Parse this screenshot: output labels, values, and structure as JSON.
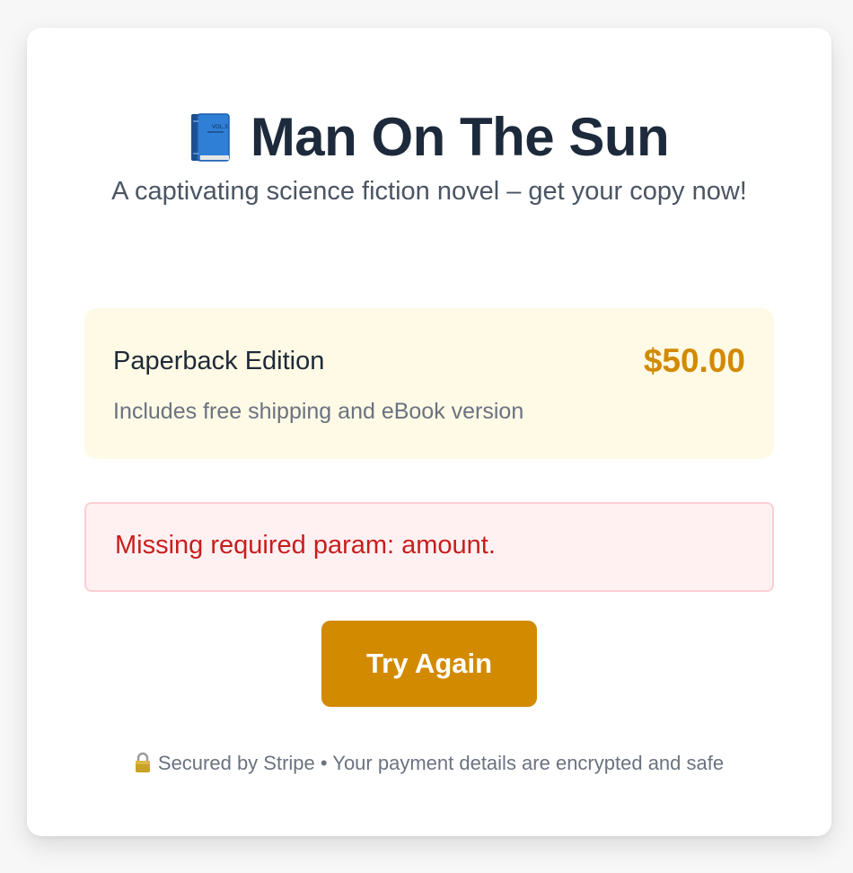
{
  "header": {
    "book_icon": "blue-book-icon",
    "title": "Man On The Sun",
    "subtitle": "A captivating science fiction novel – get your copy now!"
  },
  "product": {
    "name": "Paperback Edition",
    "price": "$50.00",
    "description": "Includes free shipping and eBook version"
  },
  "error": {
    "message": "Missing required param: amount."
  },
  "actions": {
    "try_again_label": "Try Again"
  },
  "footer": {
    "lock_icon": "lock-icon",
    "text": "Secured by Stripe • Your payment details are encrypted and safe"
  },
  "colors": {
    "accent": "#d28a00",
    "title": "#1d2a3b",
    "product_bg": "#fefae6",
    "error_bg": "#fff1f2",
    "error_border": "#fbcfd3",
    "error_text": "#c81e1e"
  }
}
